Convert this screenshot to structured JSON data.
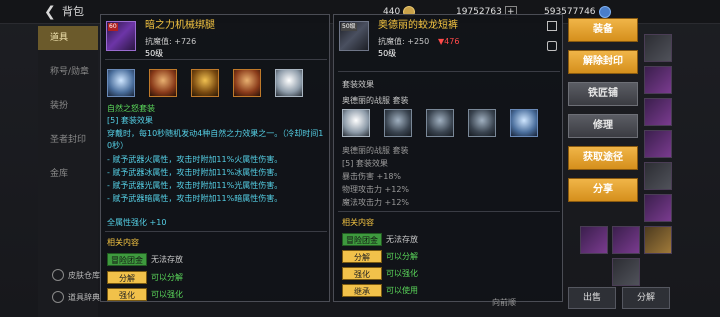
{
  "topbar": {
    "title": "背包",
    "gold": "440",
    "currency2": "19752763",
    "currency3": "593577746"
  },
  "left_menu": [
    "道具",
    "称号/勋章",
    "装扮",
    "圣者封印",
    "金库"
  ],
  "bottom_links": [
    "皮肤仓库",
    "道具辞典"
  ],
  "item1": {
    "level_tag": "60",
    "name": "暗之力机械绑腿",
    "stat": "抗魔值: +726",
    "level": "50级",
    "set_name": "自然之怒套装",
    "set_effect_title": "[5] 套装效果",
    "desc_line1": "穿戴时，每10秒随机发动4种自然之力效果之一。（冷却时间1",
    "desc_line2": "0秒）",
    "effects": [
      "- 赋予武器火属性，攻击时附加11%火属性伤害。",
      "- 赋予武器冰属性，攻击时附加11%冰属性伤害。",
      "- 赋予武器光属性，攻击时附加11%光属性伤害。",
      "- 赋予武器暗属性，攻击时附加11%暗属性伤害。"
    ],
    "all_attr": "全属性强化 +10",
    "related_title": "相关内容",
    "rows": [
      {
        "tag": "冒险团金库",
        "value": "无法存放"
      },
      {
        "tag": "分解",
        "value": "可以分解"
      },
      {
        "tag": "强化",
        "value": "可以强化"
      }
    ]
  },
  "item2": {
    "level_tag": "50级",
    "name": "奥德丽的蛟龙短裤",
    "stat": "抗魔值: +250",
    "stat_diff": "▼476",
    "level": "50级",
    "set_title": "套装效果",
    "set_name": "奥德丽的战服 套装",
    "set_name2": "奥德丽的战服 套装",
    "set_effect_title": "[5] 套装效果",
    "effects": [
      "暴击伤害 +18%",
      "物理攻击力 +12%",
      "魔法攻击力 +12%"
    ],
    "related_title": "相关内容",
    "rows": [
      {
        "tag": "冒险团金库",
        "value": "无法存放"
      },
      {
        "tag": "分解",
        "value": "可以分解"
      },
      {
        "tag": "强化",
        "value": "可以强化"
      },
      {
        "tag": "继承",
        "value": "可以使用"
      }
    ]
  },
  "actions": [
    "装备",
    "解除封印",
    "铁匠铺",
    "修理",
    "获取途径",
    "分享"
  ],
  "bottom_buttons": [
    "出售",
    "分解"
  ],
  "sort_label": "向前顺"
}
